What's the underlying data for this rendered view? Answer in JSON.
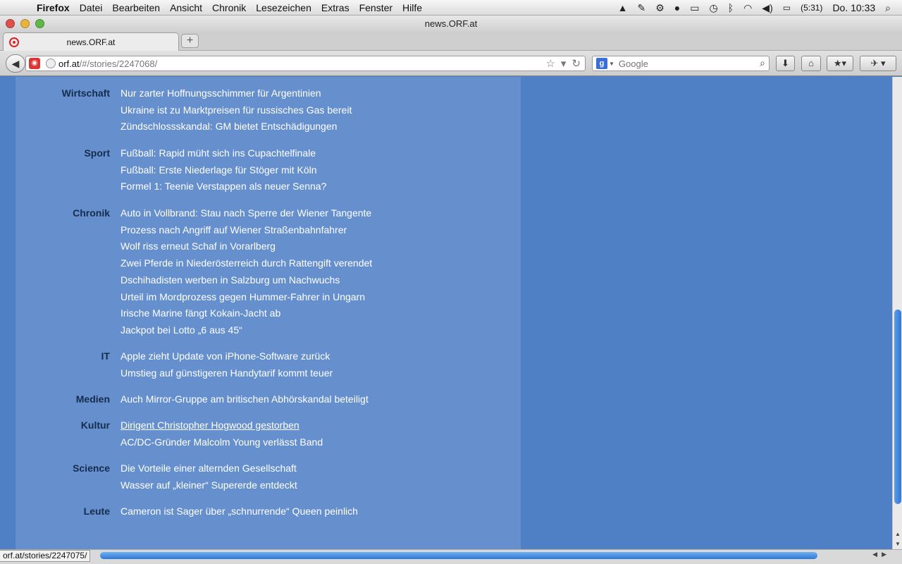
{
  "menubar": {
    "apple": "",
    "app": "Firefox",
    "items": [
      "Datei",
      "Bearbeiten",
      "Ansicht",
      "Chronik",
      "Lesezeichen",
      "Extras",
      "Fenster",
      "Hilfe"
    ],
    "battery": "(5:31)",
    "clock": "Do. 10:33"
  },
  "window": {
    "title": "news.ORF.at"
  },
  "tabs": [
    {
      "label": "news.ORF.at"
    }
  ],
  "newtab": "+",
  "nav": {
    "back": "◀",
    "url_host": "orf.at",
    "url_path": "/#/stories/2247068/",
    "search_placeholder": "Google"
  },
  "sections": [
    {
      "label": "Wirtschaft",
      "links": [
        "Nur zarter Hoffnungsschimmer für Argentinien",
        "Ukraine ist zu Marktpreisen für russisches Gas bereit",
        "Zündschlossskandal: GM bietet Entschädigungen"
      ]
    },
    {
      "label": "Sport",
      "links": [
        "Fußball: Rapid müht sich ins Cupachtelfinale",
        "Fußball: Erste Niederlage für Stöger mit Köln",
        "Formel 1: Teenie Verstappen als neuer Senna?"
      ]
    },
    {
      "label": "Chronik",
      "links": [
        "Auto in Vollbrand: Stau nach Sperre der Wiener Tangente",
        "Prozess nach Angriff auf Wiener Straßenbahnfahrer",
        "Wolf riss erneut Schaf in Vorarlberg",
        "Zwei Pferde in Niederösterreich durch Rattengift verendet",
        "Dschihadisten werben in Salzburg um Nachwuchs",
        "Urteil im Mordprozess gegen Hummer-Fahrer in Ungarn",
        "Irische Marine fängt Kokain-Jacht ab",
        "Jackpot bei Lotto „6 aus 45“"
      ]
    },
    {
      "label": "IT",
      "links": [
        "Apple zieht Update von iPhone-Software zurück",
        "Umstieg auf günstigeren Handytarif kommt teuer"
      ]
    },
    {
      "label": "Medien",
      "links": [
        "Auch Mirror-Gruppe am britischen Abhörskandal beteiligt"
      ]
    },
    {
      "label": "Kultur",
      "links": [
        "Dirigent Christopher Hogwood gestorben",
        "AC/DC-Gründer Malcolm Young verlässt Band"
      ]
    },
    {
      "label": "Science",
      "links": [
        "Die Vorteile einer alternden Gesellschaft",
        "Wasser auf „kleiner“ Supererde entdeckt"
      ]
    },
    {
      "label": "Leute",
      "links": [
        "Cameron ist Sager über „schnurrende“ Queen peinlich"
      ]
    }
  ],
  "status_url": "orf.at/stories/2247075/",
  "colors": {
    "page_bg": "#4f7fc4",
    "column_bg": "#6690cd",
    "section_label": "#142c4e",
    "link": "#ffffff"
  }
}
